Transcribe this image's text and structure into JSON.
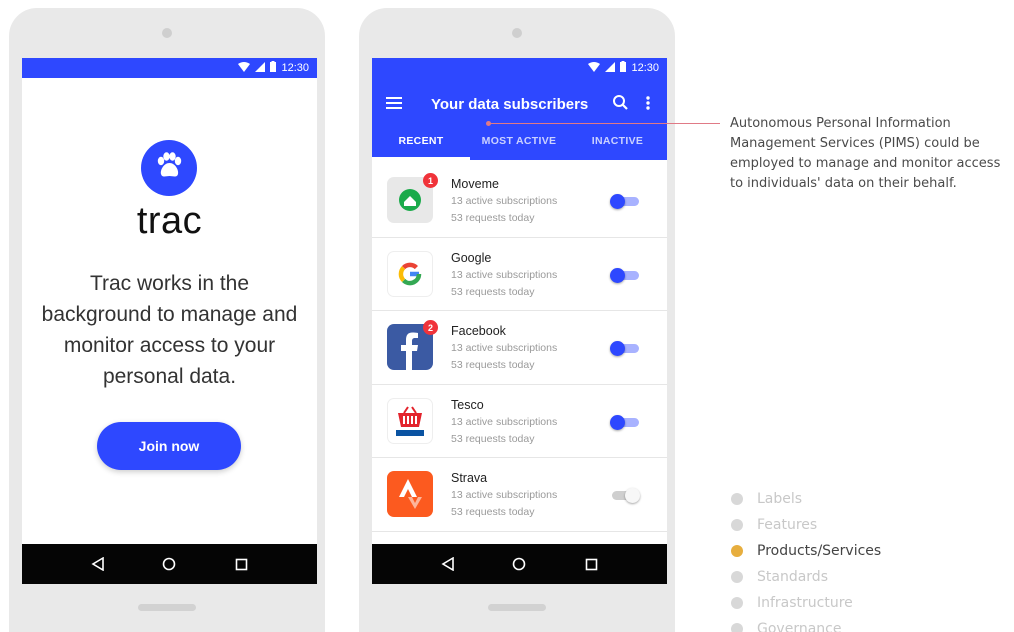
{
  "status_bar": {
    "time": "12:30"
  },
  "screen1": {
    "brand": "trac",
    "intro": "Trac works in the background to manage and monitor access to your personal data.",
    "join_button": "Join now"
  },
  "screen2": {
    "title": "Your data subscribers",
    "tabs": [
      {
        "label": "RECENT",
        "active": true
      },
      {
        "label": "MOST ACTIVE",
        "active": false
      },
      {
        "label": "INACTIVE",
        "active": false
      }
    ],
    "subscribers": [
      {
        "name": "Moveme",
        "subscriptions": "13 active subscriptions",
        "requests": "53 requests today",
        "badge": "1",
        "enabled": true,
        "icon": "moveme-icon"
      },
      {
        "name": "Google",
        "subscriptions": "13 active subscriptions",
        "requests": "53 requests today",
        "badge": null,
        "enabled": true,
        "icon": "google-icon"
      },
      {
        "name": "Facebook",
        "subscriptions": "13 active subscriptions",
        "requests": "53 requests today",
        "badge": "2",
        "enabled": true,
        "icon": "facebook-icon"
      },
      {
        "name": "Tesco",
        "subscriptions": "13 active subscriptions",
        "requests": "53 requests today",
        "badge": null,
        "enabled": true,
        "icon": "tesco-icon"
      },
      {
        "name": "Strava",
        "subscriptions": "13 active subscriptions",
        "requests": "53 requests today",
        "badge": null,
        "enabled": false,
        "icon": "strava-icon"
      }
    ]
  },
  "annotation": "Autonomous Personal Information Management Services (PIMS) could be employed to manage and monitor access to individuals' data on their behalf.",
  "legend": [
    {
      "label": "Labels",
      "active": false
    },
    {
      "label": "Features",
      "active": false
    },
    {
      "label": "Products/Services",
      "active": true
    },
    {
      "label": "Standards",
      "active": false
    },
    {
      "label": "Infrastructure",
      "active": false
    },
    {
      "label": "Governance",
      "active": false
    }
  ],
  "colors": {
    "primary": "#2e48ff",
    "badge": "#f0333a",
    "legend_active": "#e7ae3e",
    "connector": "#e07a86"
  }
}
